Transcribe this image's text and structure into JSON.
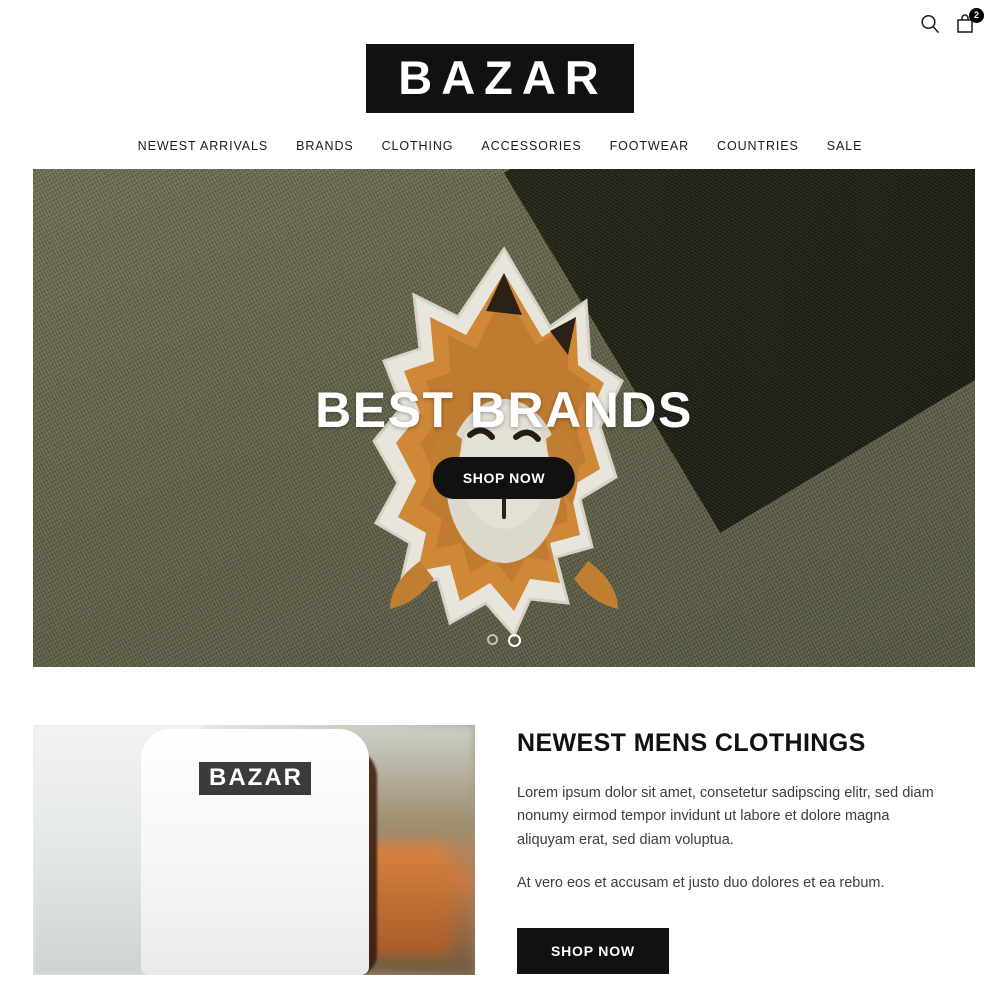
{
  "header": {
    "logo_text": "BAZAR",
    "search_icon": "search-icon",
    "cart_icon": "shopping-bag-icon",
    "cart_count": "2"
  },
  "nav": {
    "items": [
      {
        "label": "NEWEST ARRIVALS"
      },
      {
        "label": "BRANDS"
      },
      {
        "label": "CLOTHING"
      },
      {
        "label": "ACCESSORIES"
      },
      {
        "label": "FOOTWEAR"
      },
      {
        "label": "COUNTRIES"
      },
      {
        "label": "SALE"
      }
    ]
  },
  "hero": {
    "title": "BEST BRANDS",
    "cta_label": "SHOP NOW",
    "image_description": "embroidered fox patch on olive green knit fabric",
    "slides_total": 2,
    "active_slide": 2,
    "background_color": "#5c5c42",
    "dark_corner_color": "#22221a"
  },
  "feature": {
    "image_logo_text": "BAZAR",
    "image_description": "man wearing white BAZAR t-shirt",
    "title": "NEWEST MENS CLOTHINGS",
    "paragraph_1": "Lorem ipsum dolor sit amet, consetetur sadipscing elitr, sed diam nonumy eirmod tempor invidunt ut labore et dolore magna aliquyam erat, sed diam voluptua.",
    "paragraph_2": "At vero eos et accusam et justo duo dolores et ea rebum.",
    "cta_label": "SHOP NOW"
  },
  "colors": {
    "accent_black": "#111111",
    "text_dark": "#1b1b1b",
    "text_body": "#3d3d3d"
  }
}
